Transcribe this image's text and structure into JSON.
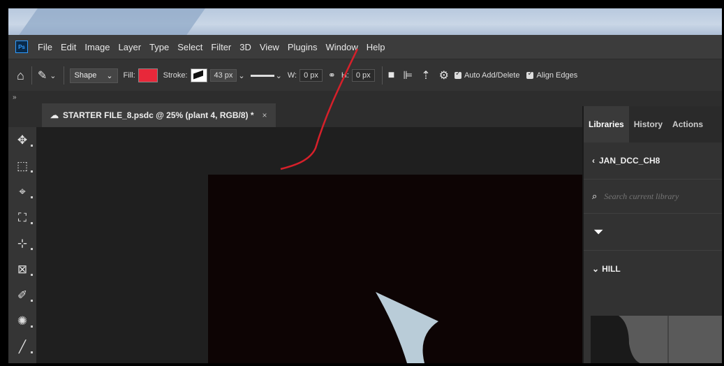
{
  "app": {
    "logo_text": "Ps"
  },
  "menu": [
    "File",
    "Edit",
    "Image",
    "Layer",
    "Type",
    "Select",
    "Filter",
    "3D",
    "View",
    "Plugins",
    "Window",
    "Help"
  ],
  "options_bar": {
    "mode": "Shape",
    "fill_label": "Fill:",
    "fill_color": "#e8283a",
    "stroke_label": "Stroke:",
    "stroke_width": "43 px",
    "w_label": "W:",
    "w_value": "0 px",
    "h_label": "H:",
    "h_value": "0 px",
    "auto_add_delete": "Auto Add/Delete",
    "align_edges": "Align Edges"
  },
  "document_tab": {
    "title": "STARTER FILE_8.psdc @ 25% (plant 4, RGB/8) *",
    "close": "×"
  },
  "collapse_glyph": "»",
  "panel": {
    "tabs": [
      "Libraries",
      "History",
      "Actions"
    ],
    "library_name": "JAN_DCC_CH8",
    "search_placeholder": "Search current library",
    "group_name": "HILL"
  }
}
